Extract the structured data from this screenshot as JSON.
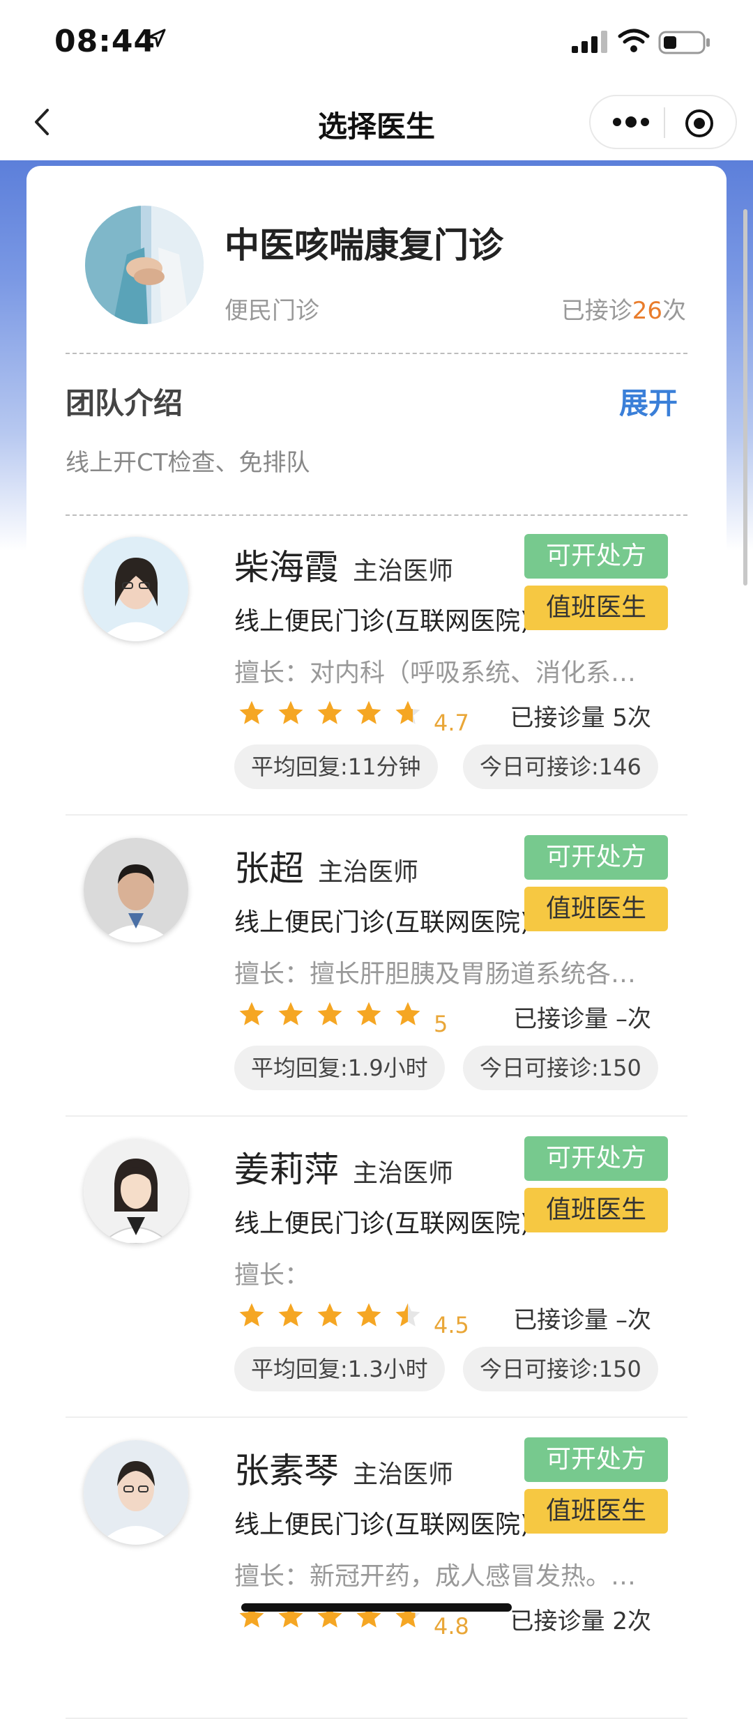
{
  "status_bar": {
    "time": "08:44"
  },
  "nav": {
    "title": "选择医生"
  },
  "clinic": {
    "name": "中医咳喘康复门诊",
    "type": "便民门诊",
    "count_prefix": "已接诊",
    "count": "26",
    "count_suffix": "次"
  },
  "team": {
    "title": "团队介绍",
    "expand": "展开",
    "desc": "线上开CT检查、免排队"
  },
  "doctors": [
    {
      "name": "柴海霞",
      "title": "主治医师",
      "hospital": "线上便民门诊(互联网医院)",
      "badge_rx": "可开处方",
      "badge_duty": "值班医生",
      "skill": "擅长：对内科（呼吸系统、消化系统等）常见病多发病的诊治",
      "rating": "4.7",
      "rating_value": 4.7,
      "consult": "已接诊量 5次",
      "avg_reply": "平均回复:11分钟",
      "today": "今日可接诊:146"
    },
    {
      "name": "张超",
      "title": "主治医师",
      "hospital": "线上便民门诊(互联网医院)",
      "badge_rx": "可开处方",
      "badge_duty": "值班医生",
      "skill": "擅长：擅长肝胆胰及胃肠道系统各种疾病的诊治",
      "rating": "5",
      "rating_value": 5,
      "consult": "已接诊量 –次",
      "avg_reply": "平均回复:1.9小时",
      "today": "今日可接诊:150"
    },
    {
      "name": "姜莉萍",
      "title": "主治医师",
      "hospital": "线上便民门诊(互联网医院)",
      "badge_rx": "可开处方",
      "badge_duty": "值班医生",
      "skill": "擅长：",
      "rating": "4.5",
      "rating_value": 4.5,
      "consult": "已接诊量 –次",
      "avg_reply": "平均回复:1.3小时",
      "today": "今日可接诊:150"
    },
    {
      "name": "张素琴",
      "title": "主治医师",
      "hospital": "线上便民门诊(互联网医院)",
      "badge_rx": "可开处方",
      "badge_duty": "值班医生",
      "skill": "擅长：新冠开药，成人感冒发热。其他常见病",
      "rating": "4.8",
      "rating_value": 4.8,
      "consult": "已接诊量 2次",
      "avg_reply": "",
      "today": ""
    }
  ],
  "colors": {
    "accent_blue": "#3a7fd8",
    "rx_green": "#77c98e",
    "duty_yellow": "#f6c842",
    "star": "#f5a623",
    "count_orange": "#e97c2b"
  }
}
